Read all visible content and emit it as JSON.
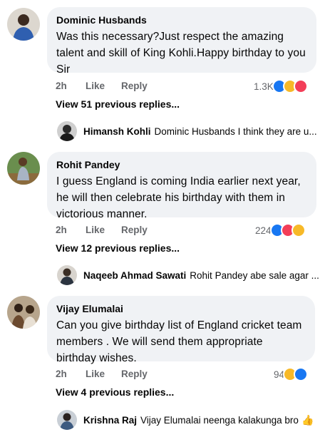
{
  "comments": [
    {
      "author": "Dominic Husbands",
      "text": "Was this necessary?Just respect the amazing talent and skill of King Kohli.Happy birthday to you Sir",
      "time": "2h",
      "like_label": "Like",
      "reply_label": "Reply",
      "reaction_count": "1.3K",
      "reactions": [
        "like-icon",
        "haha-icon",
        "love-icon"
      ],
      "view_more": "View 51 previous replies...",
      "reply_author": "Himansh Kohli",
      "reply_text": "Dominic Husbands I think they are u..."
    },
    {
      "author": "Rohit Pandey",
      "text": "I guess England is coming India earlier next year, he will then celebrate his birthday with them in victorious manner.",
      "time": "2h",
      "like_label": "Like",
      "reply_label": "Reply",
      "reaction_count": "224",
      "reactions": [
        "like-icon",
        "love-icon",
        "haha-icon"
      ],
      "view_more": "View 12 previous replies...",
      "reply_author": "Naqeeb Ahmad Sawati",
      "reply_text": "Rohit Pandey abe sale agar ..."
    },
    {
      "author": "Vijay Elumalai",
      "text": "Can you give birthday list of England cricket team members . We will send them appropriate birthday wishes.",
      "time": "2h",
      "like_label": "Like",
      "reply_label": "Reply",
      "reaction_count": "94",
      "reactions": [
        "haha-icon",
        "like-icon"
      ],
      "view_more": "View 4 previous replies...",
      "reply_author": "Krishna Raj",
      "reply_text": "Vijay Elumalai  neenga kalakunga bro"
    }
  ],
  "colors": {
    "bubble": "#f0f2f5",
    "meta": "#65676b",
    "like": "#1877f2",
    "haha": "#f7b928",
    "love": "#f33e58"
  }
}
